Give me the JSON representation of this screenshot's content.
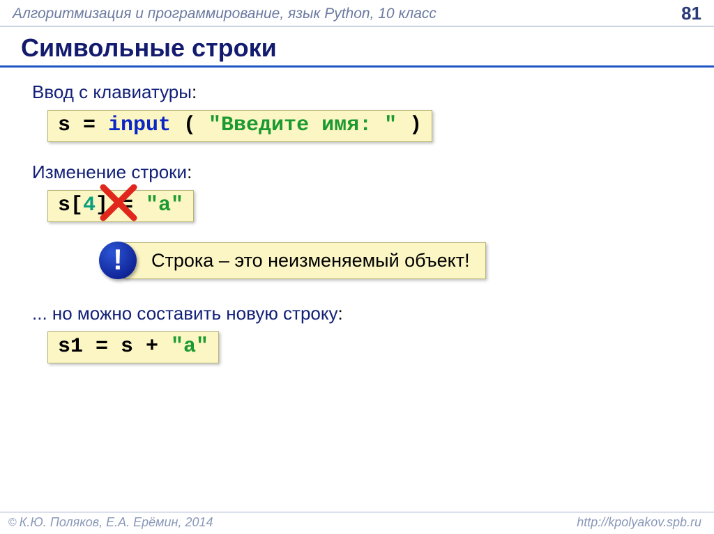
{
  "header": {
    "course": "Алгоритмизация и программирование, язык Python, 10 класс",
    "page": "81"
  },
  "title": "Символьные строки",
  "section1": {
    "label": "Ввод с клавиатуры",
    "code_pre": "s = ",
    "code_fn": "input",
    "code_paren_open": " ( ",
    "code_str": "\"Введите имя: \"",
    "code_paren_close": " )"
  },
  "section2": {
    "label": "Изменение строки",
    "code_pre": "s[",
    "code_idx": "4",
    "code_mid": "] = ",
    "code_str": "\"a\""
  },
  "note": {
    "bang": "!",
    "text": "Строка – это неизменяемый объект!"
  },
  "section3": {
    "label": "... но можно составить новую строку",
    "code_pre": "s1 = s + ",
    "code_str": "\"a\""
  },
  "footer": {
    "copy": "©",
    "authors": "К.Ю. Поляков, Е.А. Ерёмин, 2014",
    "url": "http://kpolyakov.spb.ru"
  }
}
